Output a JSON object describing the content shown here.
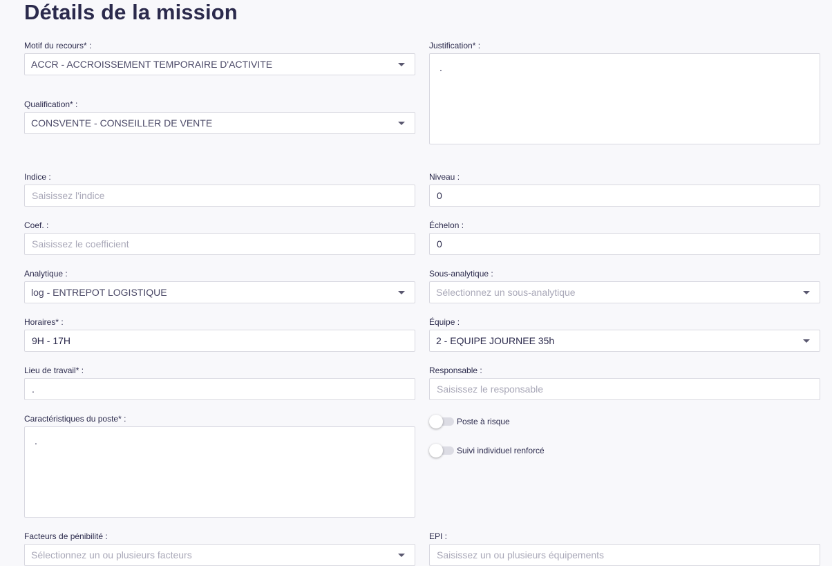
{
  "page": {
    "title": "Détails de la mission"
  },
  "fields": {
    "motif": {
      "label": "Motif du recours* :",
      "value": "ACCR - ACCROISSEMENT TEMPORAIRE D'ACTIVITE"
    },
    "justification": {
      "label": "Justification* :",
      "value": "."
    },
    "qualification": {
      "label": "Qualification* :",
      "value": "CONSVENTE - CONSEILLER DE VENTE"
    },
    "indice": {
      "label": "Indice :",
      "placeholder": "Saisissez l'indice"
    },
    "niveau": {
      "label": "Niveau :",
      "value": "0"
    },
    "coef": {
      "label": "Coef. :",
      "placeholder": "Saisissez le coefficient"
    },
    "echelon": {
      "label": "Échelon :",
      "value": "0"
    },
    "analytique": {
      "label": "Analytique :",
      "value": "log - ENTREPOT LOGISTIQUE"
    },
    "sous_analytique": {
      "label": "Sous-analytique :",
      "placeholder": "Sélectionnez un sous-analytique"
    },
    "horaires": {
      "label": "Horaires* :",
      "value": "9H - 17H"
    },
    "equipe": {
      "label": "Équipe :",
      "value": "2 - EQUIPE JOURNEE 35h"
    },
    "lieu": {
      "label": "Lieu de travail* :",
      "value": "."
    },
    "responsable": {
      "label": "Responsable :",
      "placeholder": "Saisissez le responsable"
    },
    "caracteristiques": {
      "label": "Caractéristiques du poste* :",
      "value": "."
    },
    "poste_risque": {
      "label": "Poste à risque",
      "on": false
    },
    "suivi_renforce": {
      "label": "Suivi individuel renforcé",
      "on": false
    },
    "facteurs": {
      "label": "Facteurs de pénibilité :",
      "placeholder": "Sélectionnez un ou plusieurs facteurs"
    },
    "epi": {
      "label": "EPI :",
      "placeholder": "Saisissez un ou plusieurs équipements"
    }
  },
  "icons": {
    "dropdown": "chevron-down-icon"
  },
  "colors": {
    "text": "#2b2a4c",
    "placeholder": "#a9a8b8",
    "border": "#d8d8e0",
    "background": "#f8f8fb",
    "toggle_off": "#dcdce4"
  }
}
